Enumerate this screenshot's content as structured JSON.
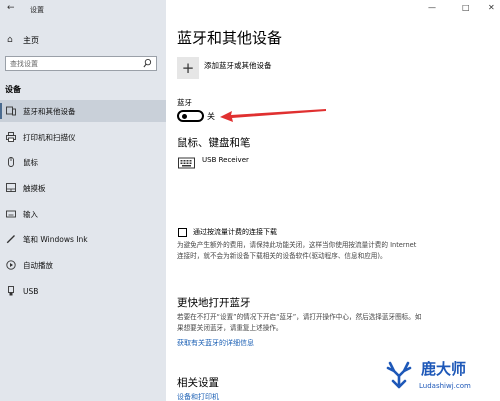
{
  "window": {
    "title": "设置",
    "controls": {
      "minimize": "—",
      "maximize": "□",
      "close": "✕"
    }
  },
  "sidebar": {
    "home_label": "主页",
    "search_placeholder": "查找设置",
    "section_label": "设备",
    "items": [
      {
        "label": "蓝牙和其他设备",
        "icon": "bluetooth-devices-icon",
        "active": true
      },
      {
        "label": "打印机和扫描仪",
        "icon": "printer-icon",
        "active": false
      },
      {
        "label": "鼠标",
        "icon": "mouse-icon",
        "active": false
      },
      {
        "label": "触摸板",
        "icon": "touchpad-icon",
        "active": false
      },
      {
        "label": "输入",
        "icon": "keyboard-icon",
        "active": false
      },
      {
        "label": "笔和 Windows Ink",
        "icon": "pen-icon",
        "active": false
      },
      {
        "label": "自动播放",
        "icon": "autoplay-icon",
        "active": false
      },
      {
        "label": "USB",
        "icon": "usb-icon",
        "active": false
      }
    ]
  },
  "main": {
    "page_title": "蓝牙和其他设备",
    "add_device_label": "添加蓝牙或其他设备",
    "add_button_glyph": "+",
    "bluetooth_label": "蓝牙",
    "bluetooth_state": "关",
    "mice_section_title": "鼠标、键盘和笔",
    "device_name": "USB Receiver",
    "metered_checkbox_label": "通过按流量计费的连接下载",
    "metered_desc": "为避免产生额外的费用，请保持此功能关闭，这样当你使用按流量计费的 Internet 连接时，就不会为新设备下载相关的设备软件(驱动程序、信息和应用)。",
    "quick_section_title": "更快地打开蓝牙",
    "quick_desc": "若要在不打开“设置”的情况下开启“蓝牙”，请打开操作中心，然后选择蓝牙图标。如果想要关闭蓝牙，请重复上述操作。",
    "quick_link": "获取有关蓝牙的详细信息",
    "related_title": "相关设置",
    "related_link": "设备和打印机"
  },
  "watermark": {
    "brand": "鹿大师",
    "url": "Ludashiwj.com"
  },
  "colors": {
    "sidebar_bg": "#e2e6ec",
    "accent_link": "#1a5fb4",
    "annotation_arrow": "#e03030",
    "watermark": "#1e58b8"
  }
}
